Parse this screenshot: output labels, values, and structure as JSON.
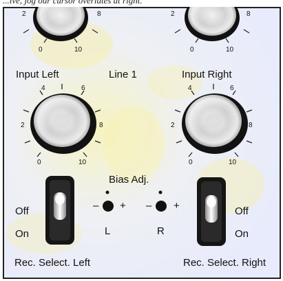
{
  "caption": "...ive, jog our cursor overlates at right.",
  "panel": {
    "top_scale_left": {
      "min": "0",
      "max": "10",
      "left_mark": "2",
      "right_mark": "8"
    },
    "top_scale_right": {
      "min": "0",
      "max": "10",
      "left_mark": "2",
      "right_mark": "8"
    },
    "input_left": {
      "label": "Input Left",
      "marks": [
        "0",
        "2",
        "4",
        "6",
        "8",
        "10"
      ]
    },
    "line_label": "Line 1",
    "input_right": {
      "label": "Input Right",
      "marks": [
        "0",
        "2",
        "4",
        "6",
        "8",
        "10"
      ]
    },
    "bias": {
      "title": "Bias Adj.",
      "left_minus": "–",
      "left_plus": "+",
      "left_channel": "L",
      "right_minus": "–",
      "right_plus": "+",
      "right_channel": "R"
    },
    "switch_left": {
      "off": "Off",
      "on": "On",
      "caption": "Rec. Select. Left"
    },
    "switch_right": {
      "off": "Off",
      "on": "On",
      "caption": "Rec. Select. Right"
    }
  },
  "colors": {
    "panel": "#eef0fb",
    "panel_warm": "#f4f1c0",
    "frame": "#222222",
    "knob_rim": "#141414",
    "knob_face": "#d7d7d7",
    "switch_body": "#151515"
  }
}
